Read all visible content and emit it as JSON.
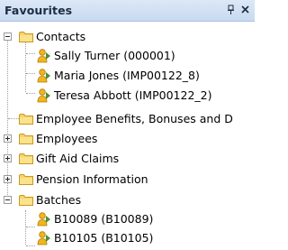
{
  "panel": {
    "title": "Favourites",
    "pin_glyph": "ᵖ",
    "close_glyph": "×"
  },
  "tree": {
    "contacts": {
      "label": "Contacts",
      "expander": "collapse",
      "children": [
        {
          "label": "Sally Turner (000001)"
        },
        {
          "label": "Maria Jones (IMP00122_8)"
        },
        {
          "label": "Teresa Abbott (IMP00122_2)"
        }
      ]
    },
    "employee_benefits": {
      "label": "Employee Benefits, Bonuses and D"
    },
    "employees": {
      "label": "Employees",
      "expander": "expand"
    },
    "gift_aid": {
      "label": "Gift Aid Claims",
      "expander": "expand"
    },
    "pension": {
      "label": "Pension Information",
      "expander": "expand"
    },
    "batches": {
      "label": "Batches",
      "expander": "collapse",
      "children": [
        {
          "label": "B10089 (B10089)"
        },
        {
          "label": "B10105 (B10105)"
        }
      ]
    }
  },
  "icons": {
    "folder": "folder-icon",
    "person": "contact-icon",
    "pin": "pin-icon",
    "close": "close-icon"
  },
  "colors": {
    "header_bg": "#c8daf0",
    "folder_fill": "#f7d46a",
    "folder_outline": "#c99a1e",
    "person_yellow": "#f2b51c",
    "person_arrow": "#4b8f2f"
  }
}
